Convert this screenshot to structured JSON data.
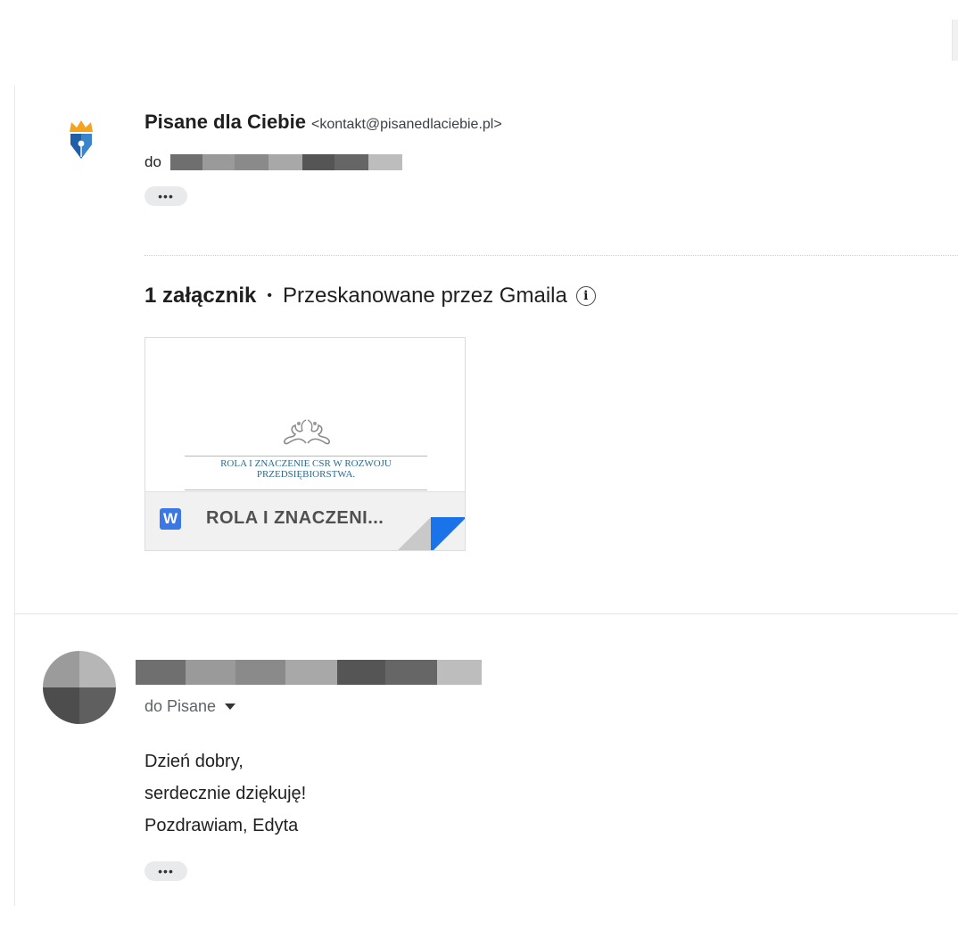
{
  "message1": {
    "sender_name": "Pisane dla Ciebie",
    "sender_email": "<kontakt@pisanedlaciebie.pl>",
    "to_prefix": "do",
    "more_label": "•••"
  },
  "attachments": {
    "count_label": "1 załącznik",
    "separator": "•",
    "scan_label": "Przeskanowane przez Gmaila",
    "info_icon": "i",
    "file": {
      "type_icon": "W",
      "name": "ROLA I ZNACZENI...",
      "preview_title_line1": "ROLA I ZNACZENIE CSR W ROZWOJU",
      "preview_title_line2": "PRZEDSIĘBIORSTWA."
    }
  },
  "message2": {
    "to_label": "do Pisane",
    "body_lines": [
      "Dzień dobry,",
      "serdecznie dziękuję!",
      "Pozdrawiam, Edyta"
    ],
    "more_label": "•••"
  },
  "colors": {
    "accent_blue": "#1a73e8",
    "word_blue": "#3b78e7",
    "redaction_greys": [
      "#6f6f6f",
      "#9a9a9a",
      "#8a8a8a",
      "#a8a8a8",
      "#555555",
      "#666666",
      "#bdbdbd"
    ]
  }
}
